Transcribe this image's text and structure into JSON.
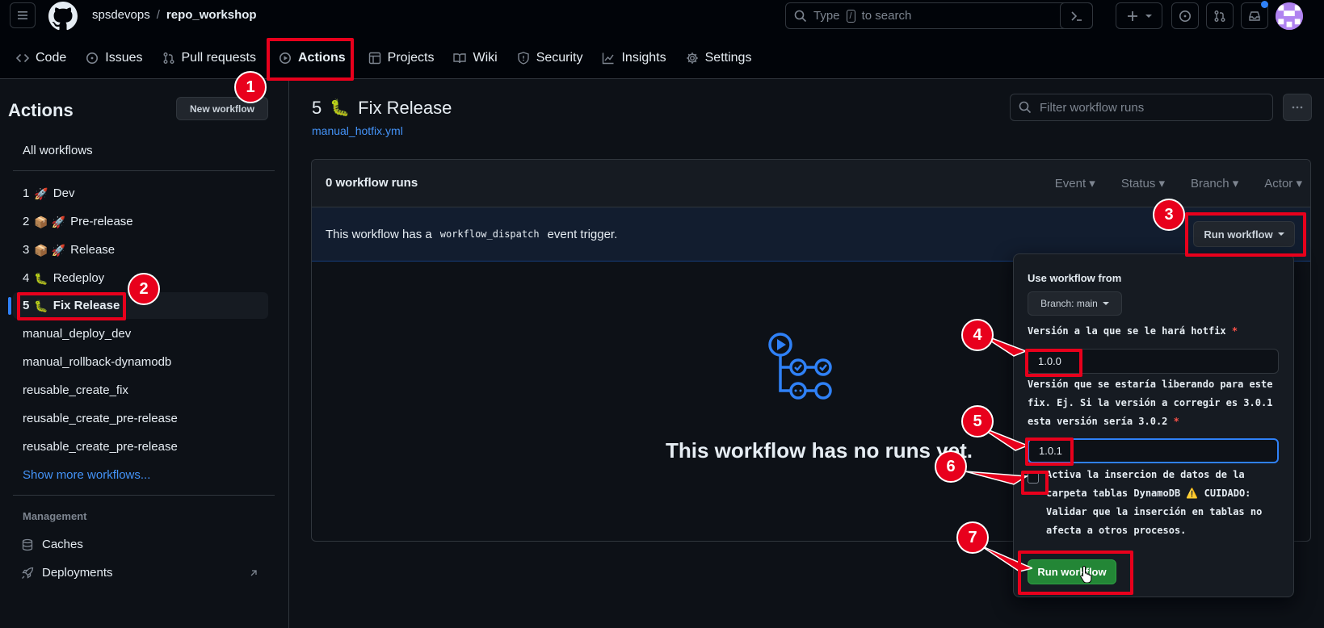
{
  "header": {
    "owner": "spsdevops",
    "separator": "/",
    "repo": "repo_workshop",
    "search_placeholder_pre": "Type",
    "search_key": "/",
    "search_placeholder_post": "to search"
  },
  "tabs": [
    {
      "label": "Code",
      "icon": "code-icon"
    },
    {
      "label": "Issues",
      "icon": "issue-icon"
    },
    {
      "label": "Pull requests",
      "icon": "pull-request-icon"
    },
    {
      "label": "Actions",
      "icon": "play-icon",
      "active": true
    },
    {
      "label": "Projects",
      "icon": "table-icon"
    },
    {
      "label": "Wiki",
      "icon": "book-icon"
    },
    {
      "label": "Security",
      "icon": "shield-icon"
    },
    {
      "label": "Insights",
      "icon": "graph-icon"
    },
    {
      "label": "Settings",
      "icon": "gear-icon"
    }
  ],
  "sidebar": {
    "title": "Actions",
    "new_workflow": "New workflow",
    "all_workflows": "All workflows",
    "workflows": [
      {
        "num": "1",
        "emoji": "🚀",
        "name": "Dev"
      },
      {
        "num": "2",
        "emoji": "📦 🚀",
        "name": "Pre-release"
      },
      {
        "num": "3",
        "emoji": "📦 🚀",
        "name": "Release"
      },
      {
        "num": "4",
        "emoji": "🐛",
        "name": "Redeploy"
      },
      {
        "num": "5",
        "emoji": "🐛",
        "name": "Fix Release",
        "selected": true
      },
      {
        "name": "manual_deploy_dev"
      },
      {
        "name": "manual_rollback-dynamodb"
      },
      {
        "name": "reusable_create_fix"
      },
      {
        "name": "reusable_create_pre-release"
      },
      {
        "name": "reusable_create_pre-release"
      }
    ],
    "show_more": "Show more workflows...",
    "management_title": "Management",
    "management": [
      {
        "label": "Caches",
        "icon": "database-icon"
      },
      {
        "label": "Deployments",
        "icon": "rocket-icon"
      }
    ]
  },
  "main": {
    "title_num": "5",
    "title_emoji": "🐛",
    "title_name": "Fix Release",
    "file": "manual_hotfix.yml",
    "filter_placeholder": "Filter workflow runs",
    "runs_count": "0 workflow runs",
    "filters": [
      "Event",
      "Status",
      "Branch",
      "Actor"
    ],
    "dispatch_pre": "This workflow has a",
    "dispatch_code": "workflow_dispatch",
    "dispatch_post": "event trigger.",
    "run_workflow": "Run workflow",
    "empty_title": "This workflow has no runs yet."
  },
  "panel": {
    "use_from": "Use workflow from",
    "branch": "Branch: main",
    "field1_label": "Versión a la que se le hará hotfix",
    "field1_value": "1.0.0",
    "field2_label_l1": "Versión que se estaría liberando para este",
    "field2_label_l2": "fix. Ej. Si la versión a corregir es 3.0.1",
    "field2_label_l3": "esta versión sería 3.0.2",
    "field2_value": "1.0.1",
    "required": "*",
    "check_l1": "Activa la insercion de datos de la",
    "check_l2a": "carpeta tablas DynamoDB",
    "check_warn": "⚠️",
    "check_l2b": "CUIDADO:",
    "check_l3": "Validar que la inserción en tablas no",
    "check_l4": "afecta a otros procesos.",
    "submit": "Run workflow"
  },
  "annotations": [
    "1",
    "2",
    "3",
    "4",
    "5",
    "6",
    "7"
  ],
  "colors": {
    "annotation": "#e8001c",
    "accent": "#2f81f7",
    "success": "#238636"
  }
}
